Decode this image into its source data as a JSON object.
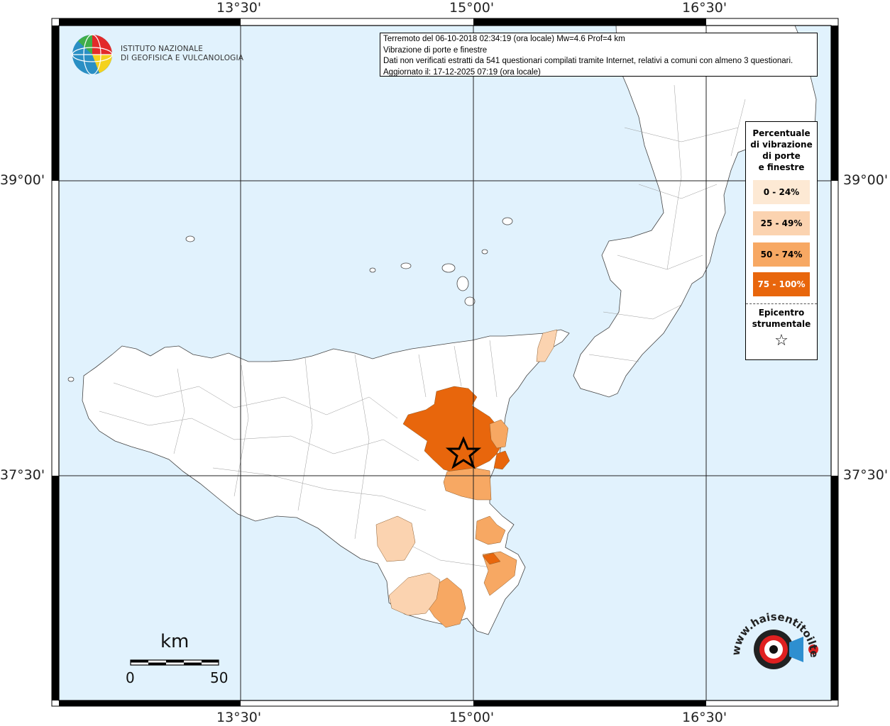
{
  "frame": {
    "lon_labels": [
      "13°30'",
      "15°00'",
      "16°30'"
    ],
    "lat_labels": [
      "39°00'",
      "37°30'"
    ]
  },
  "header": {
    "logo_lines": [
      "ISTITUTO NAZIONALE",
      "DI GEOFISICA E VULCANOLOGIA"
    ],
    "info_lines": [
      "Terremoto del 06-10-2018 02:34:19 (ora locale) Mw=4.6 Prof=4 km",
      "Vibrazione di porte e finestre",
      "Dati non verificati estratti da 541 questionari compilati tramite Internet, relativi a comuni con almeno 3 questionari.",
      "Aggiornato il: 17-12-2025 07:19 (ora locale)"
    ]
  },
  "legend": {
    "title": [
      "Percentuale",
      "di vibrazione",
      "di porte",
      "e finestre"
    ],
    "classes": [
      {
        "label": "0 - 24%",
        "color": "#fde9d4"
      },
      {
        "label": "25 - 49%",
        "color": "#fbd3b0"
      },
      {
        "label": "50 - 74%",
        "color": "#f7a863"
      },
      {
        "label": "75 - 100%",
        "color": "#e8660c"
      }
    ],
    "epicenter_title": [
      "Epicentro",
      "strumentale"
    ]
  },
  "scalebar": {
    "unit": "km",
    "start": "0",
    "end": "50"
  },
  "watermark": {
    "text": "www.haisentitoilterremoto.it"
  },
  "colors": {
    "sea": "#e1f2fd",
    "land": "#ffffff",
    "border": "#555555"
  },
  "epicenter": {
    "lon": 14.9,
    "lat": 37.65
  }
}
